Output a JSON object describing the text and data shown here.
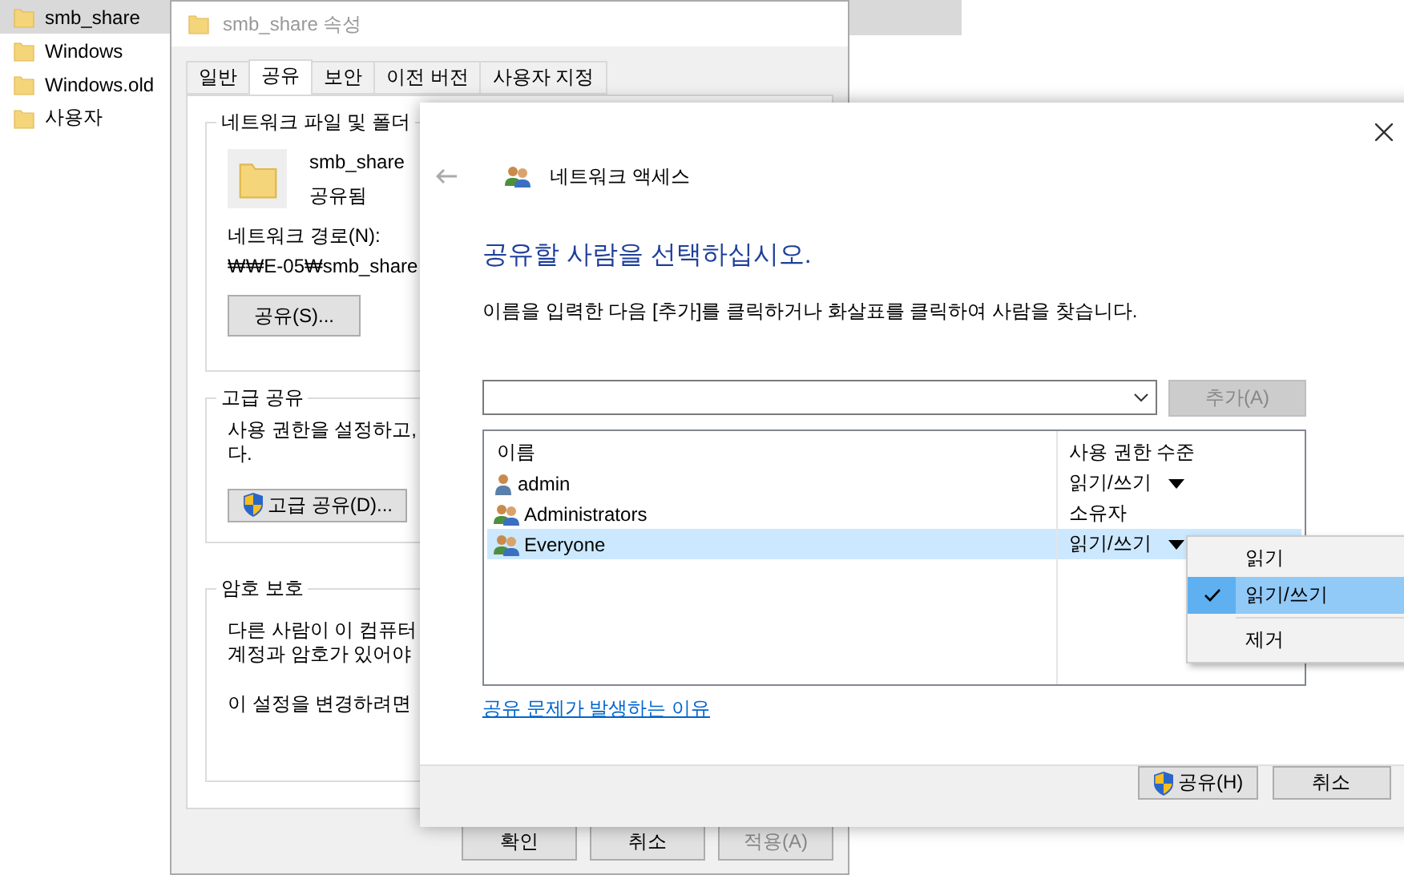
{
  "explorer": {
    "items": [
      {
        "label": "smb_share",
        "selected": true
      },
      {
        "label": "Windows",
        "selected": false
      },
      {
        "label": "Windows.old",
        "selected": false
      },
      {
        "label": "사용자",
        "selected": false
      }
    ]
  },
  "properties": {
    "title": "smb_share 속성",
    "tabs": [
      {
        "label": "일반",
        "selected": false
      },
      {
        "label": "공유",
        "selected": true
      },
      {
        "label": "보안",
        "selected": false
      },
      {
        "label": "이전 버전",
        "selected": false
      },
      {
        "label": "사용자 지정",
        "selected": false
      }
    ],
    "network": {
      "title": "네트워크 파일 및 폴더",
      "name": "smb_share",
      "status": "공유됨",
      "path_label": "네트워크 경로(N):",
      "path": "₩₩E-05₩smb_share",
      "button": "공유(S)..."
    },
    "advanced": {
      "title": "고급 공유",
      "lines": [
        "사용 권한을 설정하고,",
        "다."
      ],
      "button": "고급 공유(D)..."
    },
    "password": {
      "title": "암호 보호",
      "lines": [
        "다른 사람이 이 컴퓨터",
        "계정과 암호가 있어야"
      ],
      "note": "이 설정을 변경하려면"
    },
    "buttons": [
      {
        "label": "확인",
        "disabled": false
      },
      {
        "label": "취소",
        "disabled": false
      },
      {
        "label": "적용(A)",
        "disabled": true
      }
    ]
  },
  "sharing": {
    "title": "네트워크 액세스",
    "heading": "공유할 사람을 선택하십시오.",
    "instruction": "이름을 입력한 다음 [추가]를 클릭하거나 화살표를 클릭하여 사람을 찾습니다.",
    "add_button": {
      "label": "추가(A)",
      "disabled": true
    },
    "columns": [
      "이름",
      "사용 권한 수준"
    ],
    "rows": [
      {
        "name": "admin",
        "kind": "user",
        "permission": "읽기/쓰기",
        "dropdown": true,
        "selected": false
      },
      {
        "name": "Administrators",
        "kind": "group",
        "permission": "소유자",
        "dropdown": false,
        "selected": false
      },
      {
        "name": "Everyone",
        "kind": "group",
        "permission": "읽기/쓰기",
        "dropdown": true,
        "selected": true
      }
    ],
    "link": "공유 문제가 발생하는 이유",
    "buttons": [
      {
        "label": "공유(H)",
        "shield": true
      },
      {
        "label": "취소",
        "shield": false
      }
    ]
  },
  "menu": {
    "items": [
      {
        "label": "읽기",
        "kind": "option",
        "checked": false,
        "selected": false
      },
      {
        "label": "읽기/쓰기",
        "kind": "option",
        "checked": true,
        "selected": true
      },
      {
        "label": "제거",
        "kind": "action",
        "checked": false,
        "selected": false
      }
    ]
  }
}
